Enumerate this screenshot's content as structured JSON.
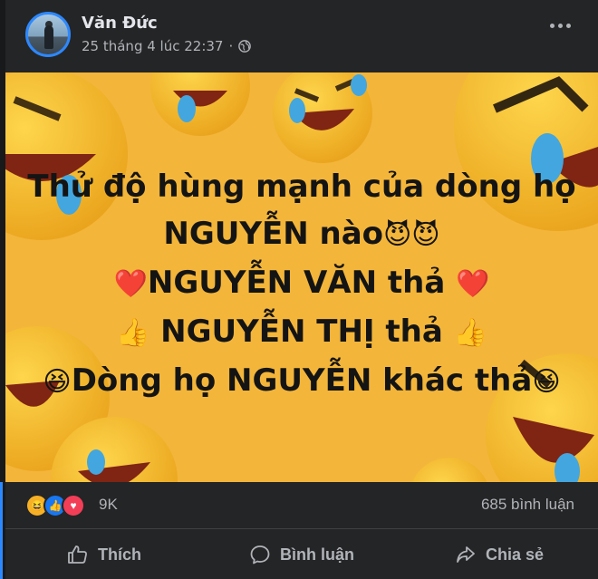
{
  "post": {
    "author": "Văn Đức",
    "timestamp": "25 tháng 4 lúc 22:37",
    "privacy_separator": "·",
    "privacy_icon": "globe-icon",
    "image_lines": [
      "Thử độ hùng mạnh của dòng họ",
      "NGUYỄN nào",
      "NGUYỄN VĂN thả",
      "NGUYỄN THỊ thả",
      "Dòng họ NGUYỄN khác thả"
    ],
    "image_emojis": {
      "devil": "😈😈",
      "heart": "❤️",
      "thumb": "👍",
      "laugh": "😆"
    },
    "background_color": "#f3b53a"
  },
  "stats": {
    "reaction_icons": [
      "haha",
      "like",
      "love"
    ],
    "reaction_glyphs": {
      "haha": "😆",
      "like": "👍",
      "love": "♥"
    },
    "reaction_count": "9K",
    "comment_count": "685 bình luận"
  },
  "actions": {
    "like": "Thích",
    "comment": "Bình luận",
    "share": "Chia sẻ"
  }
}
